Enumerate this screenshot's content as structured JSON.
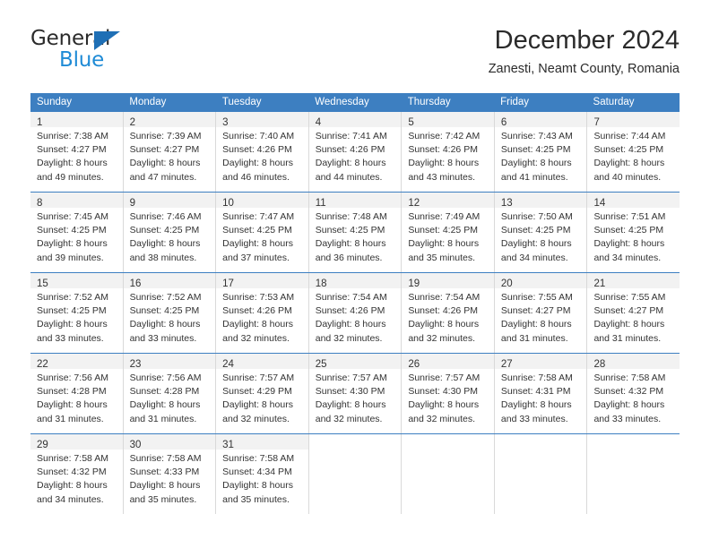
{
  "brand": {
    "name_primary": "General",
    "name_secondary": "Blue"
  },
  "header": {
    "title": "December 2024",
    "location": "Zanesti, Neamt County, Romania"
  },
  "colors": {
    "header_blue": "#3d7fc1",
    "daynum_band": "#f2f2f2",
    "logo_blue": "#1f8bd6",
    "logo_triangle": "#1f6fb5",
    "text": "#333333",
    "cell_border": "#d9d9d9"
  },
  "calendar": {
    "day_headers": [
      "Sunday",
      "Monday",
      "Tuesday",
      "Wednesday",
      "Thursday",
      "Friday",
      "Saturday"
    ],
    "weeks": [
      [
        {
          "day": "1",
          "sunrise": "Sunrise: 7:38 AM",
          "sunset": "Sunset: 4:27 PM",
          "daylight1": "Daylight: 8 hours",
          "daylight2": "and 49 minutes."
        },
        {
          "day": "2",
          "sunrise": "Sunrise: 7:39 AM",
          "sunset": "Sunset: 4:27 PM",
          "daylight1": "Daylight: 8 hours",
          "daylight2": "and 47 minutes."
        },
        {
          "day": "3",
          "sunrise": "Sunrise: 7:40 AM",
          "sunset": "Sunset: 4:26 PM",
          "daylight1": "Daylight: 8 hours",
          "daylight2": "and 46 minutes."
        },
        {
          "day": "4",
          "sunrise": "Sunrise: 7:41 AM",
          "sunset": "Sunset: 4:26 PM",
          "daylight1": "Daylight: 8 hours",
          "daylight2": "and 44 minutes."
        },
        {
          "day": "5",
          "sunrise": "Sunrise: 7:42 AM",
          "sunset": "Sunset: 4:26 PM",
          "daylight1": "Daylight: 8 hours",
          "daylight2": "and 43 minutes."
        },
        {
          "day": "6",
          "sunrise": "Sunrise: 7:43 AM",
          "sunset": "Sunset: 4:25 PM",
          "daylight1": "Daylight: 8 hours",
          "daylight2": "and 41 minutes."
        },
        {
          "day": "7",
          "sunrise": "Sunrise: 7:44 AM",
          "sunset": "Sunset: 4:25 PM",
          "daylight1": "Daylight: 8 hours",
          "daylight2": "and 40 minutes."
        }
      ],
      [
        {
          "day": "8",
          "sunrise": "Sunrise: 7:45 AM",
          "sunset": "Sunset: 4:25 PM",
          "daylight1": "Daylight: 8 hours",
          "daylight2": "and 39 minutes."
        },
        {
          "day": "9",
          "sunrise": "Sunrise: 7:46 AM",
          "sunset": "Sunset: 4:25 PM",
          "daylight1": "Daylight: 8 hours",
          "daylight2": "and 38 minutes."
        },
        {
          "day": "10",
          "sunrise": "Sunrise: 7:47 AM",
          "sunset": "Sunset: 4:25 PM",
          "daylight1": "Daylight: 8 hours",
          "daylight2": "and 37 minutes."
        },
        {
          "day": "11",
          "sunrise": "Sunrise: 7:48 AM",
          "sunset": "Sunset: 4:25 PM",
          "daylight1": "Daylight: 8 hours",
          "daylight2": "and 36 minutes."
        },
        {
          "day": "12",
          "sunrise": "Sunrise: 7:49 AM",
          "sunset": "Sunset: 4:25 PM",
          "daylight1": "Daylight: 8 hours",
          "daylight2": "and 35 minutes."
        },
        {
          "day": "13",
          "sunrise": "Sunrise: 7:50 AM",
          "sunset": "Sunset: 4:25 PM",
          "daylight1": "Daylight: 8 hours",
          "daylight2": "and 34 minutes."
        },
        {
          "day": "14",
          "sunrise": "Sunrise: 7:51 AM",
          "sunset": "Sunset: 4:25 PM",
          "daylight1": "Daylight: 8 hours",
          "daylight2": "and 34 minutes."
        }
      ],
      [
        {
          "day": "15",
          "sunrise": "Sunrise: 7:52 AM",
          "sunset": "Sunset: 4:25 PM",
          "daylight1": "Daylight: 8 hours",
          "daylight2": "and 33 minutes."
        },
        {
          "day": "16",
          "sunrise": "Sunrise: 7:52 AM",
          "sunset": "Sunset: 4:25 PM",
          "daylight1": "Daylight: 8 hours",
          "daylight2": "and 33 minutes."
        },
        {
          "day": "17",
          "sunrise": "Sunrise: 7:53 AM",
          "sunset": "Sunset: 4:26 PM",
          "daylight1": "Daylight: 8 hours",
          "daylight2": "and 32 minutes."
        },
        {
          "day": "18",
          "sunrise": "Sunrise: 7:54 AM",
          "sunset": "Sunset: 4:26 PM",
          "daylight1": "Daylight: 8 hours",
          "daylight2": "and 32 minutes."
        },
        {
          "day": "19",
          "sunrise": "Sunrise: 7:54 AM",
          "sunset": "Sunset: 4:26 PM",
          "daylight1": "Daylight: 8 hours",
          "daylight2": "and 32 minutes."
        },
        {
          "day": "20",
          "sunrise": "Sunrise: 7:55 AM",
          "sunset": "Sunset: 4:27 PM",
          "daylight1": "Daylight: 8 hours",
          "daylight2": "and 31 minutes."
        },
        {
          "day": "21",
          "sunrise": "Sunrise: 7:55 AM",
          "sunset": "Sunset: 4:27 PM",
          "daylight1": "Daylight: 8 hours",
          "daylight2": "and 31 minutes."
        }
      ],
      [
        {
          "day": "22",
          "sunrise": "Sunrise: 7:56 AM",
          "sunset": "Sunset: 4:28 PM",
          "daylight1": "Daylight: 8 hours",
          "daylight2": "and 31 minutes."
        },
        {
          "day": "23",
          "sunrise": "Sunrise: 7:56 AM",
          "sunset": "Sunset: 4:28 PM",
          "daylight1": "Daylight: 8 hours",
          "daylight2": "and 31 minutes."
        },
        {
          "day": "24",
          "sunrise": "Sunrise: 7:57 AM",
          "sunset": "Sunset: 4:29 PM",
          "daylight1": "Daylight: 8 hours",
          "daylight2": "and 32 minutes."
        },
        {
          "day": "25",
          "sunrise": "Sunrise: 7:57 AM",
          "sunset": "Sunset: 4:30 PM",
          "daylight1": "Daylight: 8 hours",
          "daylight2": "and 32 minutes."
        },
        {
          "day": "26",
          "sunrise": "Sunrise: 7:57 AM",
          "sunset": "Sunset: 4:30 PM",
          "daylight1": "Daylight: 8 hours",
          "daylight2": "and 32 minutes."
        },
        {
          "day": "27",
          "sunrise": "Sunrise: 7:58 AM",
          "sunset": "Sunset: 4:31 PM",
          "daylight1": "Daylight: 8 hours",
          "daylight2": "and 33 minutes."
        },
        {
          "day": "28",
          "sunrise": "Sunrise: 7:58 AM",
          "sunset": "Sunset: 4:32 PM",
          "daylight1": "Daylight: 8 hours",
          "daylight2": "and 33 minutes."
        }
      ],
      [
        {
          "day": "29",
          "sunrise": "Sunrise: 7:58 AM",
          "sunset": "Sunset: 4:32 PM",
          "daylight1": "Daylight: 8 hours",
          "daylight2": "and 34 minutes."
        },
        {
          "day": "30",
          "sunrise": "Sunrise: 7:58 AM",
          "sunset": "Sunset: 4:33 PM",
          "daylight1": "Daylight: 8 hours",
          "daylight2": "and 35 minutes."
        },
        {
          "day": "31",
          "sunrise": "Sunrise: 7:58 AM",
          "sunset": "Sunset: 4:34 PM",
          "daylight1": "Daylight: 8 hours",
          "daylight2": "and 35 minutes."
        },
        {
          "day": "",
          "sunrise": "",
          "sunset": "",
          "daylight1": "",
          "daylight2": ""
        },
        {
          "day": "",
          "sunrise": "",
          "sunset": "",
          "daylight1": "",
          "daylight2": ""
        },
        {
          "day": "",
          "sunrise": "",
          "sunset": "",
          "daylight1": "",
          "daylight2": ""
        },
        {
          "day": "",
          "sunrise": "",
          "sunset": "",
          "daylight1": "",
          "daylight2": ""
        }
      ]
    ]
  }
}
